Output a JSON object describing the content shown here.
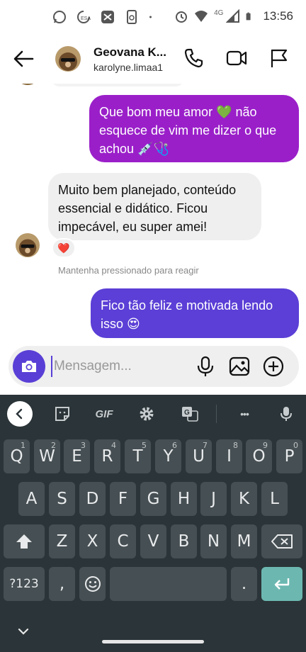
{
  "status_bar": {
    "time": "13:56",
    "network": "4G",
    "left_icons": [
      "whatsapp-icon",
      "data-saver-icon",
      "capcut-icon",
      "phone-clean-icon",
      "dot-icon"
    ],
    "right_icons": [
      "alarm-icon",
      "wifi-icon",
      "signal-icon",
      "battery-icon"
    ]
  },
  "header": {
    "contact_name": "Geovana K...",
    "contact_username": "karolyne.limaa1",
    "actions": [
      "phone-icon",
      "video-icon",
      "flag-icon"
    ]
  },
  "messages": [
    {
      "direction": "outgoing",
      "text": "Que bom meu amor 💚 não esquece de vim me dizer o que achou 💉🩺"
    },
    {
      "direction": "incoming",
      "text": "Muito bem planejado, conteúdo essencial e didático. Ficou impecável, eu super amei!",
      "reaction": "❤️"
    },
    {
      "direction": "outgoing",
      "text": "Fico tão feliz e motivada lendo isso 😍"
    }
  ],
  "hint": "Mantenha pressionado para reagir",
  "composer": {
    "placeholder": "Mensagem...",
    "icons": [
      "camera-icon",
      "microphone-icon",
      "gallery-icon",
      "add-icon"
    ]
  },
  "keyboard": {
    "toolbar": {
      "gif_label": "GIF",
      "more_label": "•••"
    },
    "row1": [
      {
        "k": "Q",
        "n": "1"
      },
      {
        "k": "W",
        "n": "2"
      },
      {
        "k": "E",
        "n": "3"
      },
      {
        "k": "R",
        "n": "4"
      },
      {
        "k": "T",
        "n": "5"
      },
      {
        "k": "Y",
        "n": "6"
      },
      {
        "k": "U",
        "n": "7"
      },
      {
        "k": "I",
        "n": "8"
      },
      {
        "k": "O",
        "n": "9"
      },
      {
        "k": "P",
        "n": "0"
      }
    ],
    "row2": [
      "A",
      "S",
      "D",
      "F",
      "G",
      "H",
      "J",
      "K",
      "L"
    ],
    "row3": [
      "Z",
      "X",
      "C",
      "V",
      "B",
      "N",
      "M"
    ],
    "symbols_label": "?123",
    "comma": ",",
    "period": "."
  },
  "colors": {
    "bubble_out_first": "#9a1fc9",
    "bubble_out_last": "#5b3fd6",
    "bubble_in": "#efefef",
    "keyboard_bg": "#2b3438",
    "key_bg": "#464f53",
    "enter_key": "#6cb8b1"
  }
}
